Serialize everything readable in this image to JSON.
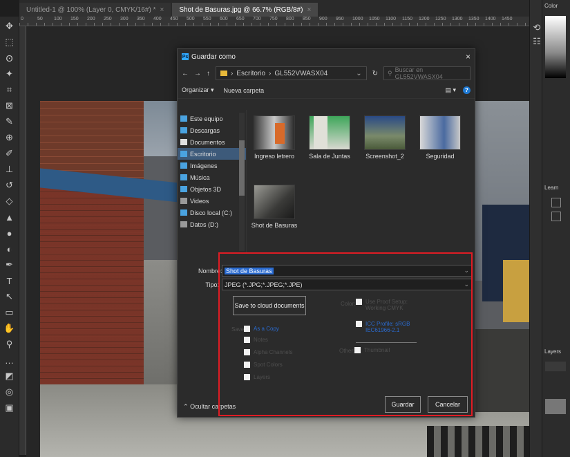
{
  "photoshop": {
    "tabs": [
      {
        "label": "Untitled-1 @ 100% (Layer 0, CMYK/16#) *",
        "close": "×"
      },
      {
        "label": "Shot de Basuras.jpg @ 66.7% (RGB/8#)",
        "close": "×"
      }
    ],
    "ruler_labels": [
      "0",
      "50",
      "100",
      "150",
      "200",
      "250",
      "300",
      "350",
      "400",
      "450",
      "500",
      "550",
      "600",
      "650",
      "700",
      "750",
      "800",
      "850",
      "900",
      "950",
      "1000",
      "1050",
      "1100",
      "1150",
      "1200",
      "1250",
      "1300",
      "1350",
      "1400",
      "1450"
    ],
    "right_panel": {
      "color_tab": "Color",
      "layers_tab": "Layers",
      "learn_tab": "Learn"
    },
    "tool_icons": [
      "move-icon",
      "marquee-icon",
      "lasso-icon",
      "magic-wand-icon",
      "crop-icon",
      "frame-icon",
      "eyedropper-icon",
      "healing-icon",
      "brush-icon",
      "stamp-icon",
      "history-brush-icon",
      "eraser-icon",
      "gradient-icon",
      "blur-icon",
      "dodge-icon",
      "pen-icon",
      "type-icon",
      "path-select-icon",
      "rectangle-icon",
      "hand-icon",
      "zoom-icon",
      "more-icon",
      "colors-icon",
      "quickmask-icon",
      "screenmode-icon"
    ]
  },
  "dialog": {
    "title": "Guardar como",
    "close": "×",
    "nav_back": "←",
    "nav_forward": "→",
    "nav_up": "↑",
    "breadcrumb": [
      "Escritorio",
      "GL552VWASX04"
    ],
    "breadcrumb_sep": "›",
    "refresh": "↻",
    "search_placeholder": "Buscar en GL552VWASX04",
    "organize": "Organizar ▾",
    "new_folder": "Nueva carpeta",
    "view_icon": "▤ ▾",
    "help": "?",
    "nav_items": [
      {
        "label": "Este equipo",
        "icon": "computer-icon",
        "color": "#4aa3e0"
      },
      {
        "label": "Descargas",
        "icon": "download-icon",
        "color": "#4aa3e0"
      },
      {
        "label": "Documentos",
        "icon": "documents-icon",
        "color": "#e0e0e0"
      },
      {
        "label": "Escritorio",
        "icon": "desktop-icon",
        "color": "#4aa3e0"
      },
      {
        "label": "Imágenes",
        "icon": "pictures-icon",
        "color": "#4aa3e0"
      },
      {
        "label": "Música",
        "icon": "music-icon",
        "color": "#4aa3e0"
      },
      {
        "label": "Objetos 3D",
        "icon": "3d-objects-icon",
        "color": "#4aa3e0"
      },
      {
        "label": "Videos",
        "icon": "videos-icon",
        "color": "#9a9a9a"
      },
      {
        "label": "Disco local (C:)",
        "icon": "drive-icon",
        "color": "#4aa3e0"
      },
      {
        "label": "Datos (D:)",
        "icon": "drive-icon",
        "color": "#9a9a9a"
      }
    ],
    "files": [
      {
        "name": "Ingreso letrero"
      },
      {
        "name": "Sala de Juntas"
      },
      {
        "name": "Screenshot_2"
      },
      {
        "name": "Seguridad"
      },
      {
        "name": "Shot de Basuras"
      }
    ],
    "filename_label": "Nombre:",
    "filename_value": "Shot de Basuras",
    "type_label": "Tipo:",
    "type_value": "JPEG (*.JPG;*.JPEG;*.JPE)",
    "cloud_button": "Save to cloud documents",
    "color_label": "Color:",
    "color_opt1": "Use Proof Setup: Working CMYK",
    "color_opt2": "ICC Profile: sRGB IEC61966-2.1",
    "save_label": "Save:",
    "save_opts": [
      "As a Copy",
      "Notes",
      "Alpha Channels",
      "Spot Colors",
      "Layers"
    ],
    "other_label": "Other:",
    "other_opt": "Thumbnail",
    "hide_folders": "Ocultar carpetas",
    "save_button": "Guardar",
    "cancel_button": "Cancelar"
  },
  "colors": {
    "annotation_red": "#e01c24",
    "selection_blue": "#2a6bd0",
    "ps_blue": "#31a8ff"
  }
}
